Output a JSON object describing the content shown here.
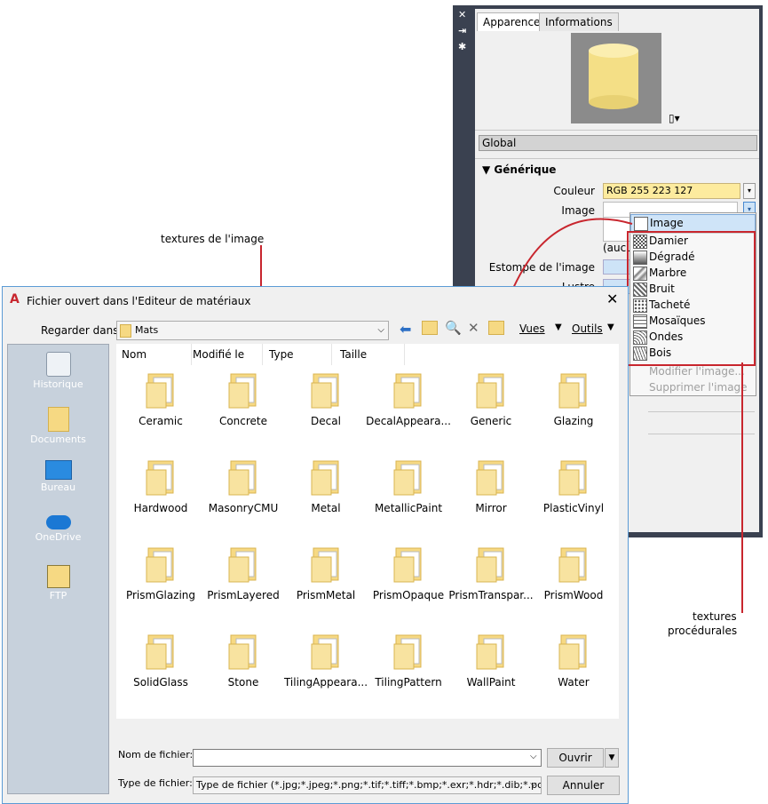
{
  "palette": {
    "tabs": [
      "Apparence",
      "Informations"
    ],
    "global_label": "Global",
    "generic_header": "Générique",
    "couleur_label": "Couleur",
    "couleur_value": "RGB 255 223 127",
    "image_label": "Image",
    "aucune_label": "(aucu",
    "estompe_label": "Estompe de l'image",
    "lustre_label": "Lustre"
  },
  "dropdown": {
    "items": [
      "Image",
      "Damier",
      "Dégradé",
      "Marbre",
      "Bruit",
      "Tacheté",
      "Mosaïques",
      "Ondes",
      "Bois"
    ],
    "disabled": [
      "Modifier l'image...",
      "Supprimer l'image"
    ]
  },
  "callouts": {
    "image_textures": "textures de l'image",
    "procedural_1": "textures",
    "procedural_2": "procédurales"
  },
  "dialog": {
    "title": "Fichier ouvert dans l'Editeur de matériaux",
    "look_in_label": "Regarder dans:",
    "look_in_value": "Mats",
    "views_label": "Vues",
    "tools_label": "Outils",
    "places": [
      "Historique",
      "Documents",
      "Bureau",
      "OneDrive",
      "FTP"
    ],
    "columns": [
      "Nom",
      "Modifié le",
      "Type",
      "Taille"
    ],
    "folders": [
      "Ceramic",
      "Concrete",
      "Decal",
      "DecalAppeara...",
      "Generic",
      "Glazing",
      "Hardwood",
      "MasonryCMU",
      "Metal",
      "MetallicPaint",
      "Mirror",
      "PlasticVinyl",
      "PrismGlazing",
      "PrismLayered",
      "PrismMetal",
      "PrismOpaque",
      "PrismTranspar...",
      "PrismWood",
      "SolidGlass",
      "Stone",
      "TilingAppeara...",
      "TilingPattern",
      "WallPaint",
      "Water"
    ],
    "filename_label": "Nom de fichier:",
    "filename_value": "",
    "filetype_label": "Type de fichier:",
    "filetype_value": "Type de fichier  (*.jpg;*.jpeg;*.png;*.tif;*.tiff;*.bmp;*.exr;*.hdr;*.dib;*.pcx;*.gif;*.tga",
    "open_button": "Ouvrir",
    "cancel_button": "Annuler"
  },
  "colors": {
    "accent_red": "#c8262e",
    "swatch": "#fdeb9e",
    "sidebar": "#c7d1dc"
  }
}
